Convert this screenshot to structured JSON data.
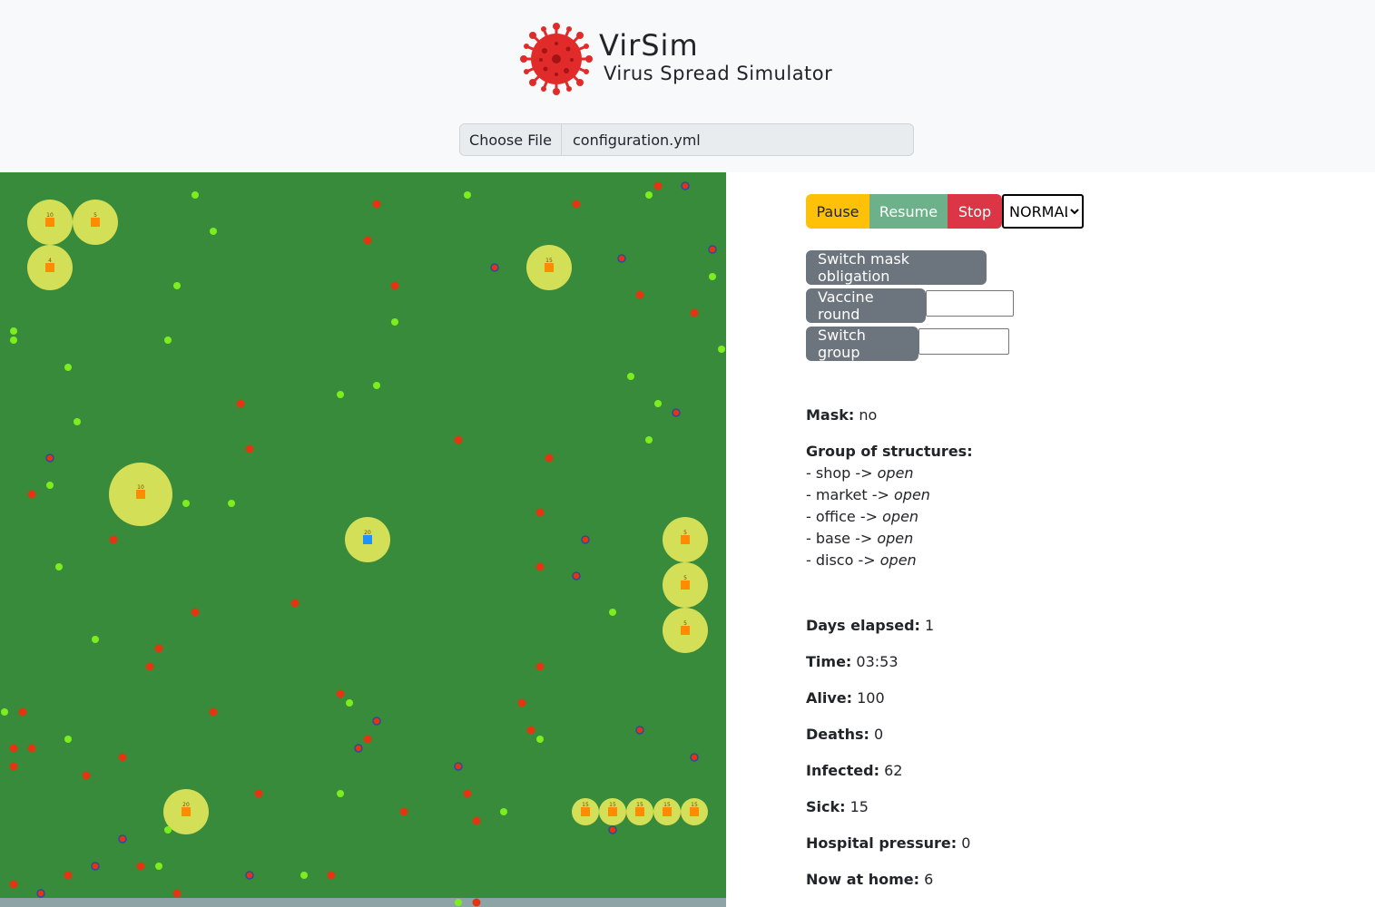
{
  "header": {
    "title": "VirSim",
    "subtitle": "Virus Spread Simulator",
    "file_button": "Choose File",
    "file_name": "configuration.yml"
  },
  "colors": {
    "field": "#378b3a",
    "structure": "#d4df58",
    "marker": "#ff8c00",
    "marker_highlight": "#1e90ff",
    "person_healthy": "#7cee1e",
    "person_infected": "#e83312",
    "person_outline": "#2e4b9a",
    "footer": "#8ea3a6"
  },
  "controls": {
    "pause": "Pause",
    "resume": "Resume",
    "stop": "Stop",
    "speed_selected": "NORMAL",
    "switch_mask": "Switch mask obligation",
    "vaccine_round": "Vaccine round",
    "switch_group": "Switch group"
  },
  "status": {
    "mask_label": "Mask:",
    "mask_value": "no",
    "groups_label": "Group of structures:",
    "groups": [
      {
        "name": "- shop ->",
        "state": "open"
      },
      {
        "name": "- market ->",
        "state": "open"
      },
      {
        "name": "- office ->",
        "state": "open"
      },
      {
        "name": "- base ->",
        "state": "open"
      },
      {
        "name": "- disco ->",
        "state": "open"
      }
    ],
    "days_label": "Days elapsed:",
    "days_value": "1",
    "time_label": "Time:",
    "time_value": "03:53",
    "alive_label": "Alive:",
    "alive_value": "100",
    "deaths_label": "Deaths:",
    "deaths_value": "0",
    "infected_label": "Infected:",
    "infected_value": "62",
    "sick_label": "Sick:",
    "sick_value": "15",
    "hospital_label": "Hospital pressure:",
    "hospital_value": "0",
    "home_label": "Now at home:",
    "home_value": "6"
  },
  "simulation": {
    "structures": [
      {
        "label": "10",
        "marker": "orange"
      },
      {
        "label": "5",
        "marker": "orange"
      },
      {
        "label": "4",
        "marker": "orange"
      },
      {
        "label": "15",
        "marker": "orange"
      },
      {
        "label": "10",
        "marker": "orange"
      },
      {
        "label": "20",
        "marker": "blue"
      },
      {
        "label": "5",
        "marker": "orange"
      },
      {
        "label": "5",
        "marker": "orange"
      },
      {
        "label": "5",
        "marker": "orange"
      },
      {
        "label": "20",
        "marker": "orange"
      },
      {
        "label": "15",
        "marker": "orange"
      },
      {
        "label": "15",
        "marker": "orange"
      },
      {
        "label": "15",
        "marker": "orange"
      },
      {
        "label": "15",
        "marker": "orange"
      },
      {
        "label": "15",
        "marker": "orange"
      }
    ]
  }
}
